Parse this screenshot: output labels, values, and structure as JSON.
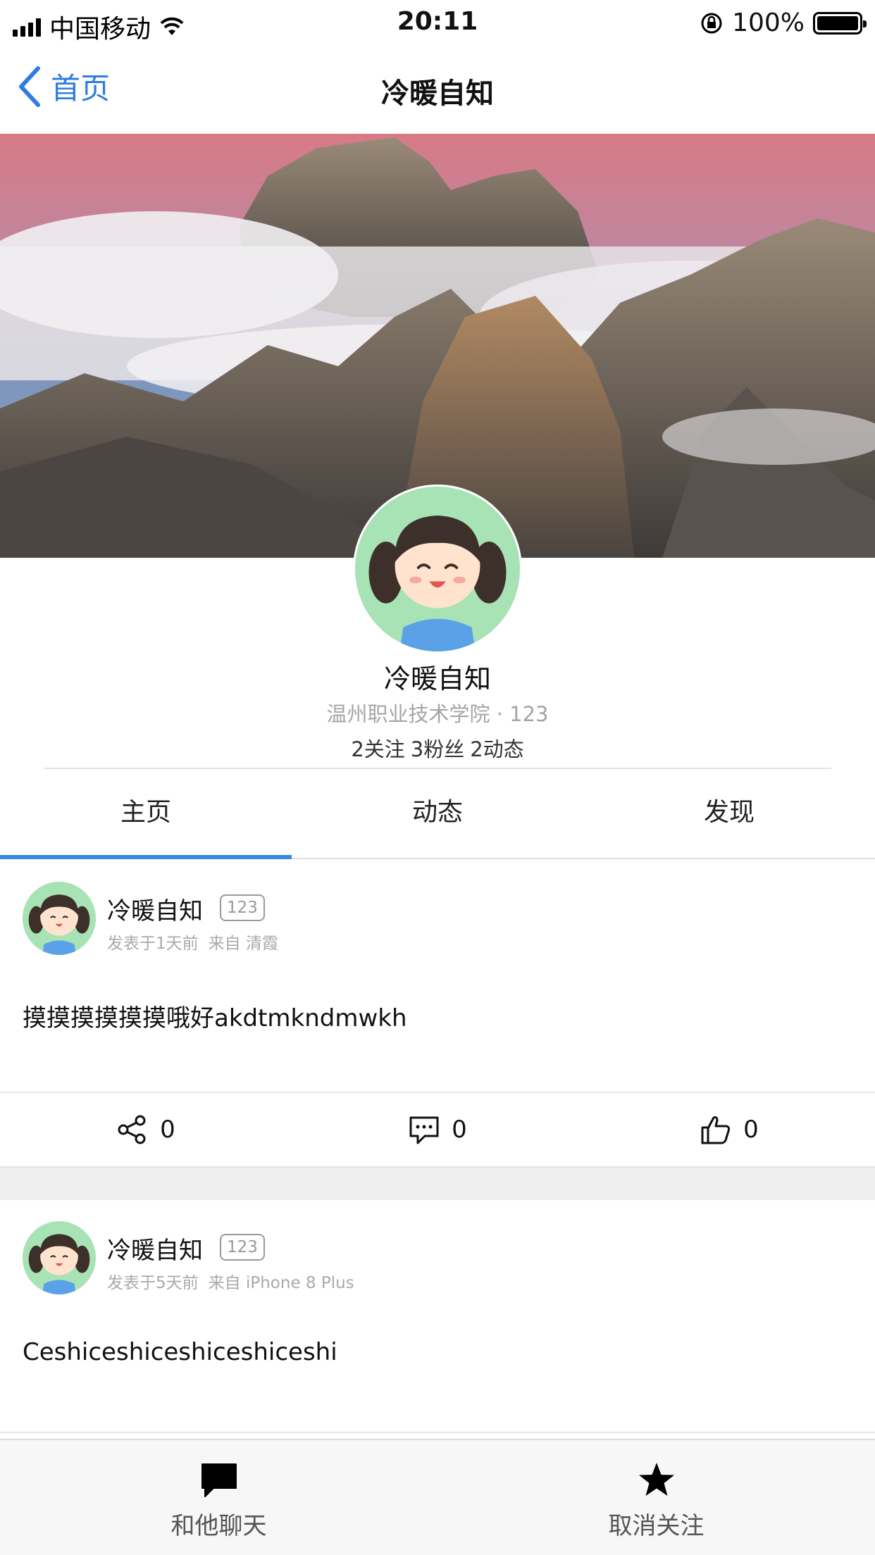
{
  "status_bar": {
    "carrier": "中国移动",
    "time": "20:11",
    "battery": "100%",
    "icons": [
      "signal-icon",
      "wifi-icon",
      "orientation-lock-icon",
      "battery-icon"
    ]
  },
  "nav": {
    "back_label": "首页",
    "title": "冷暖自知"
  },
  "profile": {
    "name": "冷暖自知",
    "school_line": "温州职业技术学院 · 123",
    "stats": {
      "following": "2关注",
      "fans": "3粉丝",
      "posts": "2动态"
    }
  },
  "tabs": [
    {
      "label": "主页",
      "active": true
    },
    {
      "label": "动态",
      "active": false
    },
    {
      "label": "发现",
      "active": false
    }
  ],
  "posts": [
    {
      "author": "冷暖自知",
      "badge": "123",
      "time": "发表于1天前",
      "source": "来自 清霞",
      "text": "摸摸摸摸摸摸哦好akdtmkndmwkh",
      "share_count": "0",
      "comment_count": "0",
      "like_count": "0"
    },
    {
      "author": "冷暖自知",
      "badge": "123",
      "time": "发表于5天前",
      "source": "来自 iPhone 8 Plus",
      "text": "Ceshiceshiceshiceshiceshi"
    }
  ],
  "bottom_bar": {
    "chat_label": "和他聊天",
    "unfollow_label": "取消关注"
  },
  "colors": {
    "accent": "#3a89e0",
    "back_link": "#2f7de1",
    "avatar_bg": "#a7e3b4"
  }
}
